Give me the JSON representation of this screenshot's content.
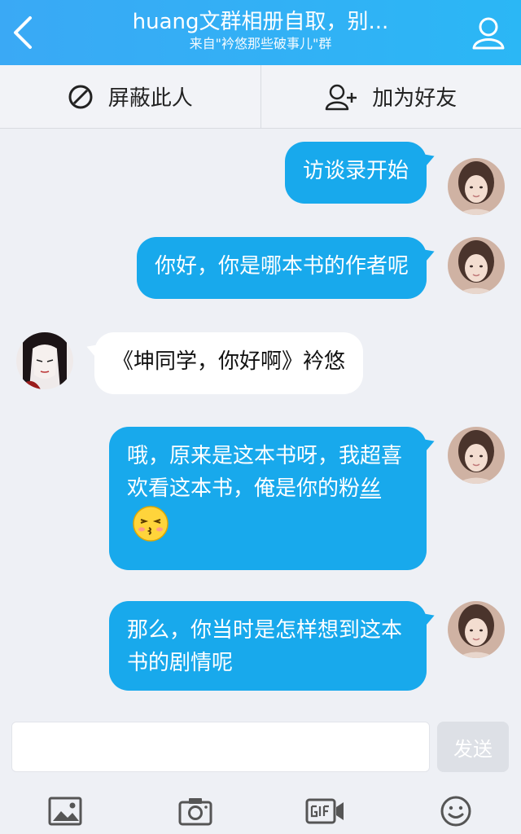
{
  "header": {
    "title": "huang文群相册自取，别...",
    "subtitle": "来自\"衿悠那些破事儿\"群"
  },
  "actions": {
    "block_label": "屏蔽此人",
    "add_friend_label": "加为好友"
  },
  "messages": [
    {
      "side": "me",
      "text": "访谈录开始"
    },
    {
      "side": "me",
      "text": "你好，你是哪本书的作者呢"
    },
    {
      "side": "them",
      "text": "《坤同学，你好啊》衿悠"
    },
    {
      "side": "me",
      "text_main": "哦，原来是这本书呀，我超喜欢看这本书，俺是你的粉",
      "text_tail": "丝",
      "emoji": "kiss-face"
    },
    {
      "side": "me",
      "text": "那么，你当时是怎样想到这本书的剧情呢"
    }
  ],
  "composer": {
    "placeholder": "",
    "send_label": "发送"
  },
  "colors": {
    "header": "#2bb7f5",
    "my_bubble": "#18a9ec",
    "their_bubble": "#ffffff",
    "background": "#eef0f5"
  },
  "icons": [
    "back-icon",
    "profile-icon",
    "block-icon",
    "add-friend-icon",
    "image-icon",
    "camera-icon",
    "gif-icon",
    "emoji-icon"
  ]
}
